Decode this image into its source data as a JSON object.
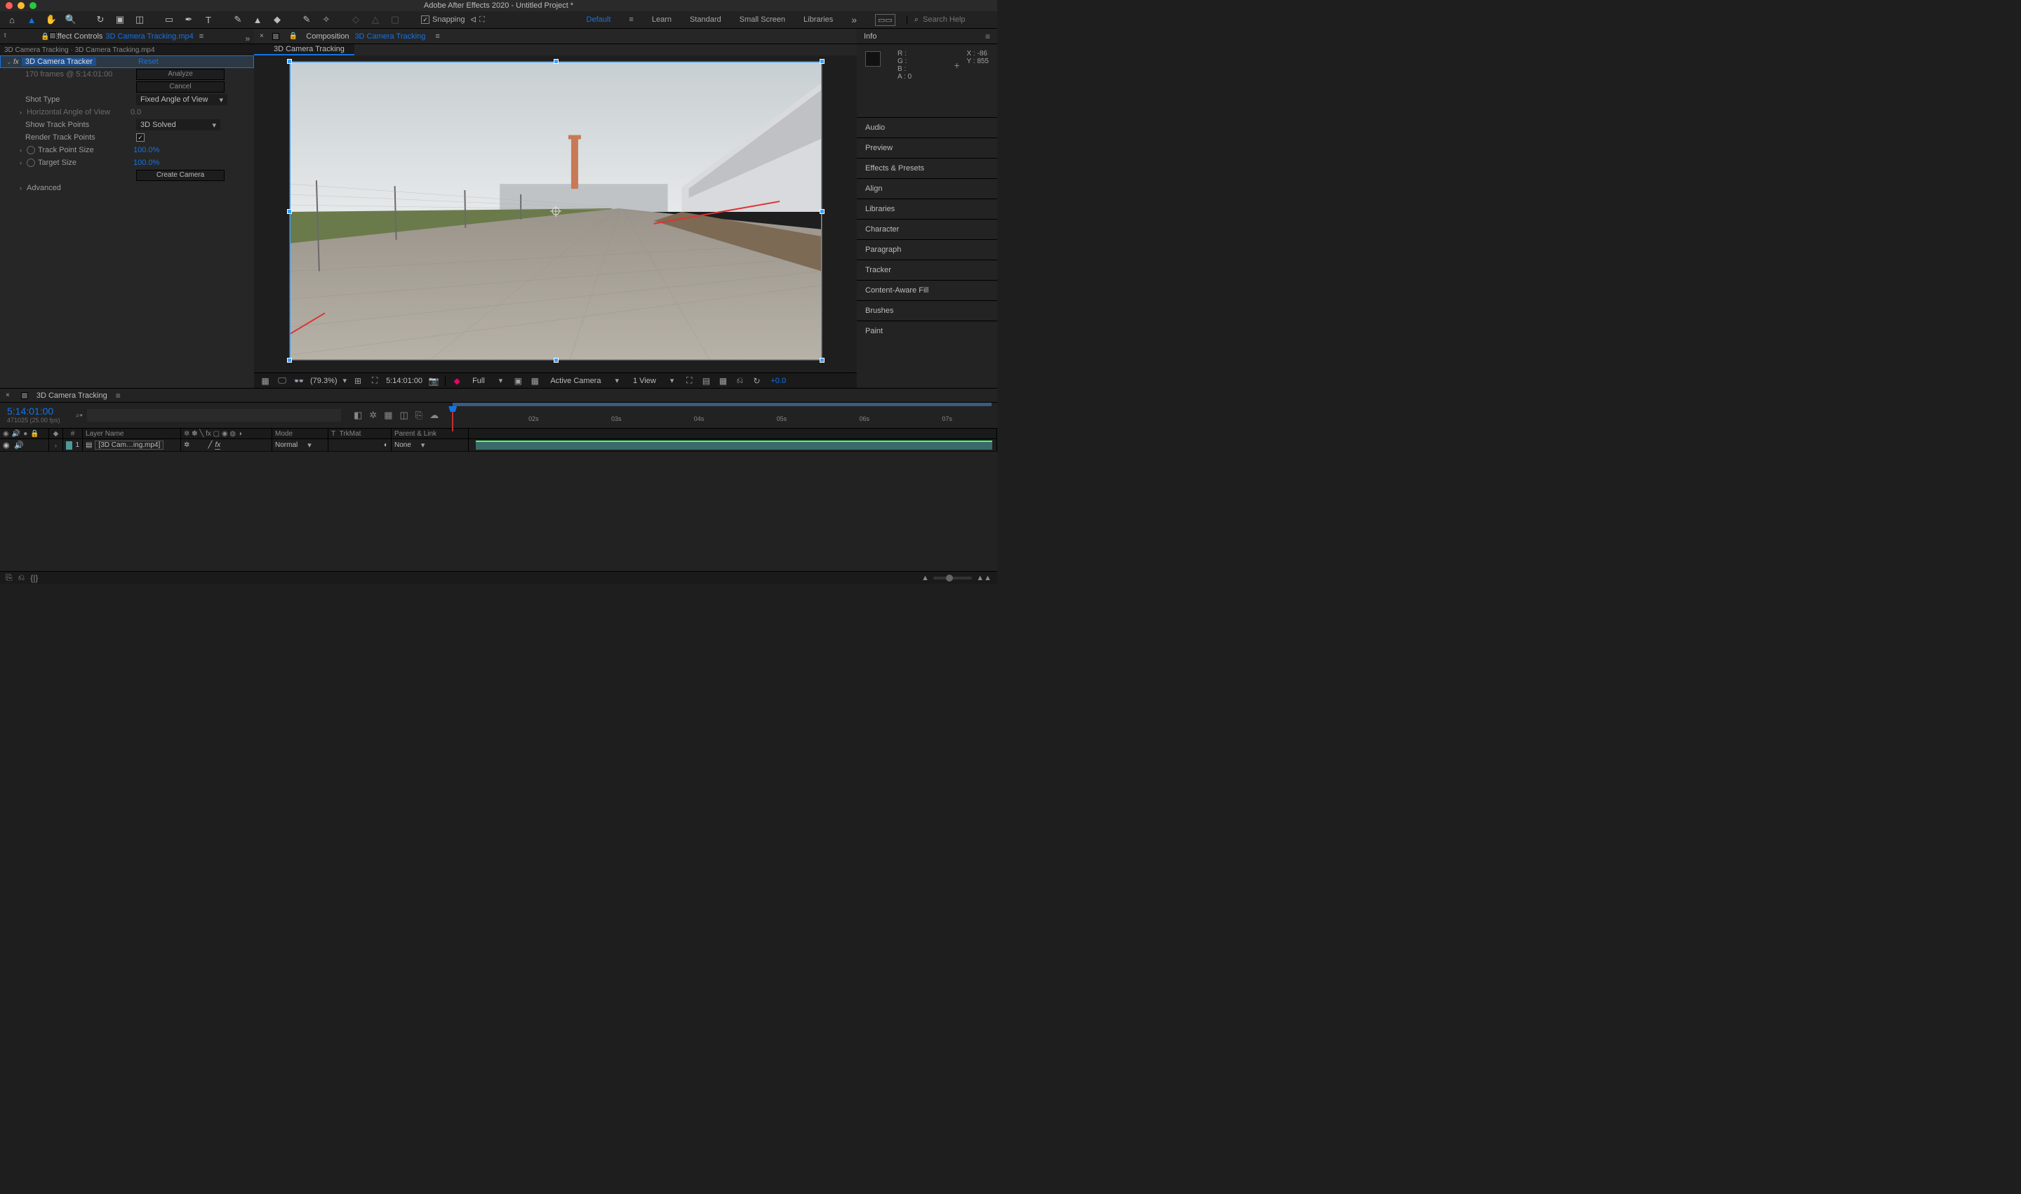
{
  "titlebar": {
    "title": "Adobe After Effects 2020 - Untitled Project *"
  },
  "toolbar": {
    "snapping_label": "Snapping",
    "workspaces": [
      "Default",
      "Learn",
      "Standard",
      "Small Screen",
      "Libraries"
    ],
    "search_placeholder": "Search Help"
  },
  "effect_controls": {
    "tab_prefix": "Effect Controls",
    "tab_file": "3D Camera Tracking.mp4",
    "breadcrumb": "3D Camera Tracking · 3D Camera Tracking.mp4",
    "effect": {
      "name": "3D Camera Tracker",
      "reset": "Reset",
      "analysis": "170 frames @ 5:14:01:00",
      "analyze_btn": "Analyze",
      "cancel_btn": "Cancel",
      "shot_type_label": "Shot Type",
      "shot_type_value": "Fixed Angle of View",
      "hav_label": "Horizontal Angle of View",
      "hav_value": "0.0",
      "show_tp_label": "Show Track Points",
      "show_tp_value": "3D Solved",
      "render_tp_label": "Render Track Points",
      "tp_size_label": "Track Point Size",
      "tp_size_value": "100.0%",
      "tgt_size_label": "Target Size",
      "tgt_size_value": "100.0%",
      "create_cam_btn": "Create Camera",
      "advanced_label": "Advanced"
    }
  },
  "composition": {
    "tab_prefix": "Composition",
    "tab_name": "3D Camera Tracking",
    "chip": "3D Camera Tracking"
  },
  "viewer_footer": {
    "zoom": "(79.3%)",
    "timecode": "5:14:01:00",
    "resolution": "Full",
    "camera": "Active Camera",
    "views": "1 View",
    "exposure": "+0.0"
  },
  "info": {
    "title": "Info",
    "r_label": "R :",
    "g_label": "G :",
    "b_label": "B :",
    "a_label": "A :",
    "a_val": "0",
    "x_label": "X :",
    "x_val": "-86",
    "y_label": "Y :",
    "y_val": "855"
  },
  "right_panels": [
    "Audio",
    "Preview",
    "Effects & Presets",
    "Align",
    "Libraries",
    "Character",
    "Paragraph",
    "Tracker",
    "Content-Aware Fill",
    "Brushes",
    "Paint"
  ],
  "timeline": {
    "tab_name": "3D Camera Tracking",
    "timecode": "5:14:01:00",
    "fps": "471025 (25.00 fps)",
    "ticks": [
      "02s",
      "03s",
      "04s",
      "05s",
      "06s",
      "07s"
    ],
    "cols": {
      "num": "#",
      "layer_name": "Layer Name",
      "mode": "Mode",
      "t": "T",
      "trkmat": "TrkMat",
      "parent": "Parent & Link"
    },
    "layer": {
      "index": "1",
      "name": "[3D Cam…ing.mp4]",
      "mode": "Normal",
      "parent": "None"
    }
  }
}
